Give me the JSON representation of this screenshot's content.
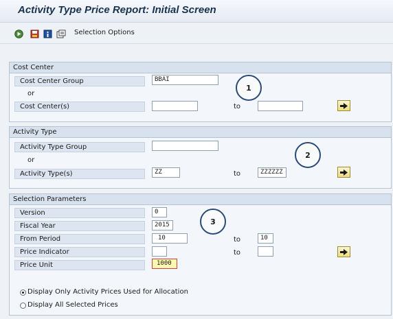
{
  "window": {
    "title": "Activity Type Price Report: Initial Screen"
  },
  "toolbar": {
    "icons": [
      "execute-icon",
      "save-variant-icon",
      "info-icon",
      "get-variant-icon"
    ],
    "selection_options": "Selection Options"
  },
  "cost_center": {
    "title": "Cost Center",
    "group_label": "Cost Center Group",
    "group_value": "BBAI",
    "or": "or",
    "centers_label": "Cost Center(s)",
    "from_value": "",
    "to_label": "to",
    "to_value": ""
  },
  "activity_type": {
    "title": "Activity Type",
    "group_label": "Activity Type Group",
    "group_value": "",
    "or": "or",
    "types_label": "Activity Type(s)",
    "from_value": "ZZ",
    "to_label": "to",
    "to_value": "ZZZZZZ"
  },
  "selection_params": {
    "title": "Selection Parameters",
    "version_label": "Version",
    "version_value": "0",
    "fiscal_year_label": "Fiscal Year",
    "fiscal_year_value": "2015",
    "from_period_label": "From Period",
    "from_period_value": "10",
    "to_label_1": "to",
    "to_period_value": "10",
    "price_indicator_label": "Price Indicator",
    "price_indicator_value": "",
    "to_label_2": "to",
    "price_indicator_to_value": "",
    "price_unit_label": "Price Unit",
    "price_unit_value": "1000"
  },
  "display_options": {
    "option1": "Display Only Activity Prices Used for Allocation",
    "option2": "Display All Selected Prices",
    "selected": "option1"
  },
  "callouts": [
    "1",
    "2",
    "3"
  ]
}
